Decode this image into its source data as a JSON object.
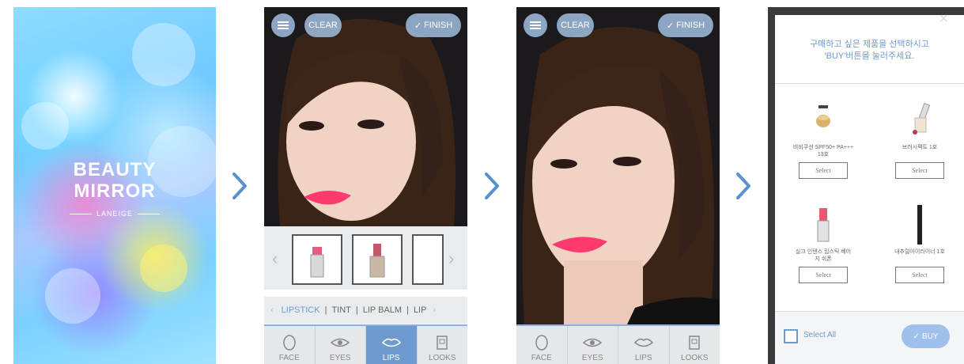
{
  "splash": {
    "brand_line1": "BEAUTY",
    "brand_line2": "MIRROR",
    "brand_sub": "LANEIGE"
  },
  "arrows": {
    "icon": "chevron-right-icon",
    "color": "#5a8fd0"
  },
  "editor": {
    "clear_label": "CLEAR",
    "finish_label": "FINISH",
    "categories": [
      "LIPSTICK",
      "TINT",
      "LIP BALM",
      "LIP"
    ],
    "active_category": "LIPSTICK",
    "tabs": [
      {
        "label": "FACE",
        "icon": "face-icon"
      },
      {
        "label": "EYES",
        "icon": "eye-icon"
      },
      {
        "label": "LIPS",
        "icon": "lips-icon"
      },
      {
        "label": "LOOKS",
        "icon": "looks-book-icon"
      }
    ],
    "active_tab": "LIPS",
    "accent": "#6f9ad0"
  },
  "popup": {
    "title_line1": "구매하고 싶은 제품을 선택하시고",
    "title_line2": "'BUY'버튼을 눌러주세요.",
    "products": [
      {
        "name_line1": "비비쿠션 SPF50+ PA+++",
        "name_line2": "13호",
        "select": "Select"
      },
      {
        "name_line1": "브러시팩트 1호",
        "name_line2": "",
        "select": "Select"
      },
      {
        "name_line1": "실크 인텐스 립스틱 베어",
        "name_line2": "지 쉬폰",
        "select": "Select"
      },
      {
        "name_line1": "내추럴아이라이너 1호",
        "name_line2": "",
        "select": "Select"
      }
    ],
    "select_all": "Select All",
    "buy": "BUY",
    "close": "×"
  }
}
